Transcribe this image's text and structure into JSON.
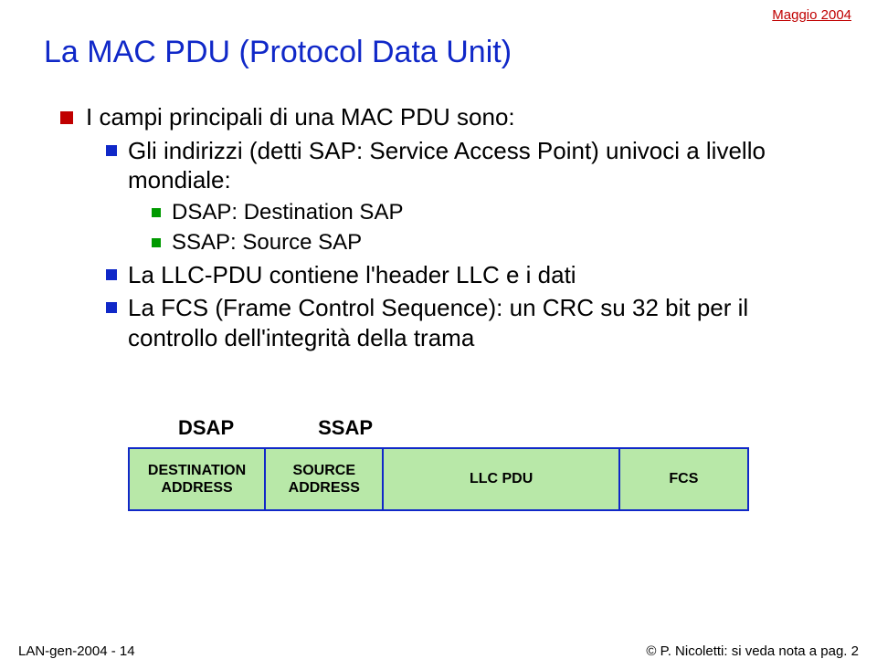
{
  "header": {
    "date": "Maggio 2004"
  },
  "title": "La MAC PDU (Protocol Data Unit)",
  "bullets": {
    "b1": "I campi principali di una MAC PDU sono:",
    "b1a": "Gli indirizzi (detti SAP: Service Access Point)  univoci a livello mondiale:",
    "b1a1": "DSAP: Destination SAP",
    "b1a2": "SSAP: Source SAP",
    "b1b": "La LLC-PDU contiene l'header LLC e i dati",
    "b1c": "La FCS (Frame Control Sequence): un CRC su 32 bit per il controllo dell'integrità della trama"
  },
  "diagram": {
    "label_dsap": "DSAP",
    "label_ssap": "SSAP",
    "cells": {
      "dest": "DESTINATION ADDRESS",
      "src": "SOURCE ADDRESS",
      "llc": "LLC PDU",
      "fcs": "FCS"
    }
  },
  "footer": {
    "left": "LAN-gen-2004 - 14",
    "right": "© P. Nicoletti: si veda nota a  pag. 2"
  }
}
